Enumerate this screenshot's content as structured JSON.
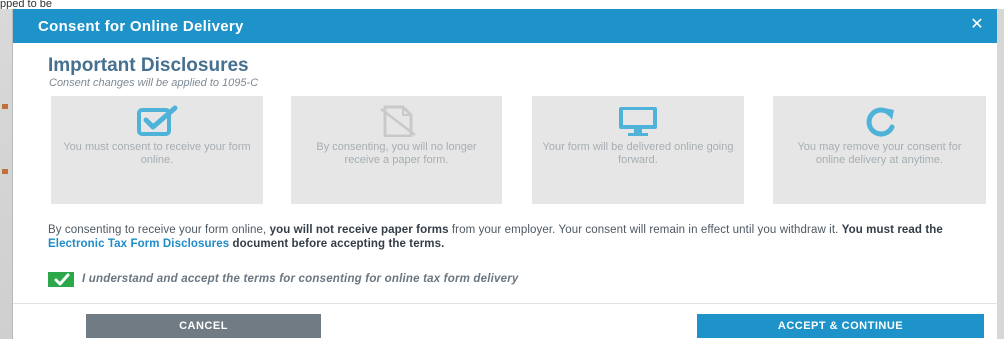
{
  "background": {
    "top_text": "pped to be"
  },
  "dialog": {
    "title": "Consent for Online Delivery",
    "close_glyph": "✕"
  },
  "disclosures": {
    "title": "Important Disclosures",
    "subtitle": "Consent changes will be applied to 1095-C"
  },
  "cards": [
    {
      "icon": "checkbox-icon",
      "text": "You must consent to receive your form online."
    },
    {
      "icon": "paper-form-icon",
      "text": "By consenting, you will no longer receive a paper form."
    },
    {
      "icon": "monitor-icon",
      "text": "Your form will be delivered online going forward."
    },
    {
      "icon": "refresh-icon",
      "text": "You may remove your consent for online delivery at anytime."
    }
  ],
  "body": {
    "part1": "By consenting to receive your form online, ",
    "bold1": "you will not receive paper forms",
    "part2": " from your employer. Your consent will remain in effect until you withdraw it. ",
    "bold2": "You must read the ",
    "link": "Electronic Tax Form Disclosures",
    "bold3": " document before accepting the terms."
  },
  "accept": {
    "checked": true,
    "label": "I understand and accept the terms for consenting for online tax form delivery"
  },
  "buttons": {
    "cancel": "CANCEL",
    "accept": "ACCEPT & CONTINUE"
  },
  "colors": {
    "header": "#1e93c9",
    "checkbox": "#2ca84a",
    "cancel": "#707b84",
    "card": "#e6e6e6",
    "icon": "#4fb3d9"
  }
}
